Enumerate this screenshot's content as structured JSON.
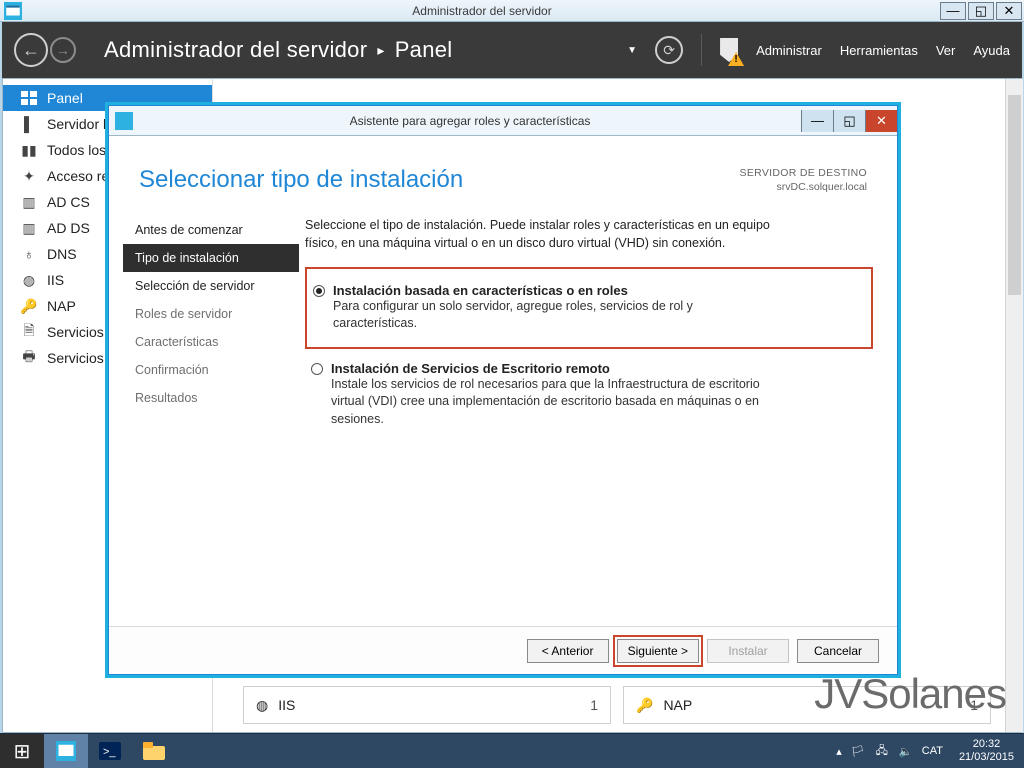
{
  "parentWindow": {
    "title": "Administrador del servidor"
  },
  "cmdbar": {
    "crumb1": "Administrador del servidor",
    "crumb2": "Panel",
    "actions": {
      "admin": "Administrar",
      "tools": "Herramientas",
      "view": "Ver",
      "help": "Ayuda"
    }
  },
  "sidebar": {
    "items": [
      {
        "label": "Panel",
        "selected": true
      },
      {
        "label": "Servidor local"
      },
      {
        "label": "Todos los servidores"
      },
      {
        "label": "Acceso remoto"
      },
      {
        "label": "AD CS"
      },
      {
        "label": "AD DS"
      },
      {
        "label": "DNS"
      },
      {
        "label": "IIS"
      },
      {
        "label": "NAP"
      },
      {
        "label": "Servicios de archivos"
      },
      {
        "label": "Servicios de impresión"
      }
    ]
  },
  "tiles": [
    {
      "label": "IIS",
      "count": "1"
    },
    {
      "label": "NAP",
      "count": "1"
    }
  ],
  "wizard": {
    "title": "Asistente para agregar roles y características",
    "heading": "Seleccionar tipo de instalación",
    "dest_label": "SERVIDOR DE DESTINO",
    "dest_server": "srvDC.solquer.local",
    "intro": "Seleccione el tipo de instalación. Puede instalar roles y características en un equipo físico, en una máquina virtual o en un disco duro virtual (VHD) sin conexión.",
    "steps": [
      {
        "label": "Antes de comenzar",
        "state": "done"
      },
      {
        "label": "Tipo de instalación",
        "state": "sel"
      },
      {
        "label": "Selección de servidor",
        "state": "done"
      },
      {
        "label": "Roles de servidor",
        "state": ""
      },
      {
        "label": "Características",
        "state": ""
      },
      {
        "label": "Confirmación",
        "state": ""
      },
      {
        "label": "Resultados",
        "state": ""
      }
    ],
    "options": [
      {
        "title": "Instalación basada en características o en roles",
        "desc": "Para configurar un solo servidor, agregue roles, servicios de rol y características.",
        "checked": true,
        "highlight": true
      },
      {
        "title": "Instalación de Servicios de Escritorio remoto",
        "desc": "Instale los servicios de rol necesarios para que la Infraestructura de escritorio virtual (VDI) cree una implementación de escritorio basada en máquinas o en sesiones.",
        "checked": false,
        "highlight": false
      }
    ],
    "footer": {
      "prev": "< Anterior",
      "next": "Siguiente >",
      "install": "Instalar",
      "cancel": "Cancelar"
    }
  },
  "watermark": "JVSolanes",
  "taskbar": {
    "lang": "CAT",
    "time": "20:32",
    "date": "21/03/2015"
  }
}
